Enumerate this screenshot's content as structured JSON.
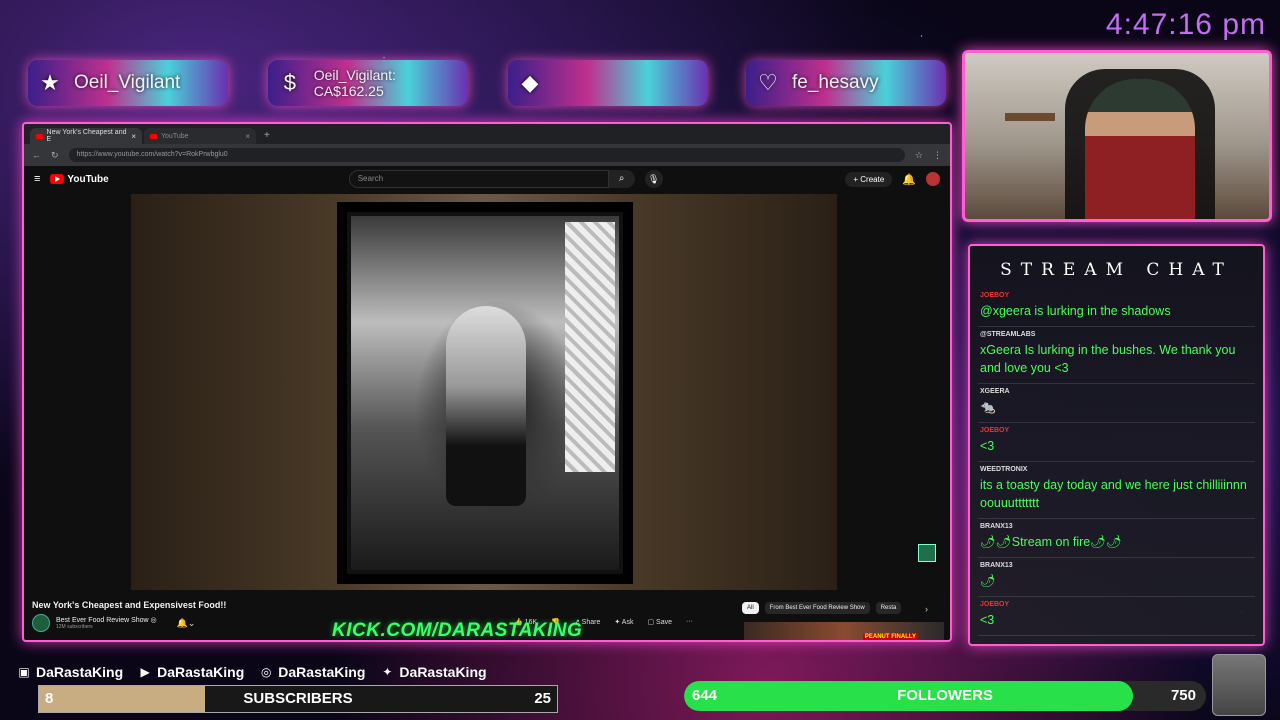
{
  "clock": "4:47:16 pm",
  "alerts": [
    {
      "icon": "star-icon",
      "glyph": "★",
      "text": "Oeil_Vigilant"
    },
    {
      "icon": "dollar-icon",
      "glyph": "$",
      "text": "Oeil_Vigilant: CA$162.25"
    },
    {
      "icon": "diamond-icon",
      "glyph": "◆",
      "text": ""
    },
    {
      "icon": "heart-icon",
      "glyph": "♡",
      "text": "fe_hesavy"
    }
  ],
  "browser": {
    "tabs": [
      "New York's Cheapest and E",
      "YouTube"
    ],
    "url": "https://www.youtube.com/watch?v=RokPrwbglu0",
    "search_placeholder": "Search",
    "create_label": "Create",
    "logo_text": "YouTube",
    "video_title": "New York's Cheapest and Expensivest Food!!",
    "channel_name": "Best Ever Food Review Show ◎",
    "channel_subs": "12M subscribers",
    "actions": {
      "like": "16K",
      "share": "Share",
      "ask": "Ask",
      "save": "Save",
      "more": "···"
    },
    "chips": [
      "All",
      "From Best Ever Food Review Show",
      "Resta"
    ],
    "overlay_thumb": "PEANUT FINALLY"
  },
  "kick_url": "KICK.COM/DARASTAKING",
  "chat": {
    "title": "STREAM CHAT",
    "messages": [
      {
        "user": "JOEBOY",
        "user_color": "red",
        "body": "@xgeera is lurking in the shadows"
      },
      {
        "user": "@STREAMLABS",
        "user_color": "normal",
        "body": "xGeera Is lurking in the bushes. We thank you and love you <3"
      },
      {
        "user": "XGEERA",
        "user_color": "normal",
        "body": "🐀"
      },
      {
        "user": "JOEBOY",
        "user_color": "red",
        "body": "<3"
      },
      {
        "user": "WEEDTRONIX",
        "user_color": "normal",
        "body": "its a toasty day today and we here just chilliiinnn oouuuttttttt"
      },
      {
        "user": "BRANX13",
        "user_color": "normal",
        "body": "🌶🌶Stream on fire🌶🌶"
      },
      {
        "user": "BRANX13",
        "user_color": "normal",
        "body": "🌶"
      },
      {
        "user": "JOEBOY",
        "user_color": "red",
        "body": "<3"
      }
    ]
  },
  "socials": [
    {
      "icon": "twitch-icon",
      "glyph": "▣",
      "handle": "DaRastaKing"
    },
    {
      "icon": "youtube-icon",
      "glyph": "▶",
      "handle": "DaRastaKing"
    },
    {
      "icon": "instagram-icon",
      "glyph": "◎",
      "handle": "DaRastaKing"
    },
    {
      "icon": "twitter-icon",
      "glyph": "✦",
      "handle": "DaRastaKing"
    }
  ],
  "subscribers": {
    "label": "SUBSCRIBERS",
    "current": "8",
    "goal": "25",
    "progress": 0.32
  },
  "followers": {
    "label": "FOLLOWERS",
    "current": "644",
    "goal": "750",
    "progress": 0.86
  },
  "colors": {
    "accent_pink": "#ff5fd2",
    "chat_green": "#46ff58",
    "kick_green": "#3bff6a",
    "clock_purple": "#c56cf0",
    "sub_fill": "#c9ad82",
    "follow_fill": "#27e04a"
  }
}
